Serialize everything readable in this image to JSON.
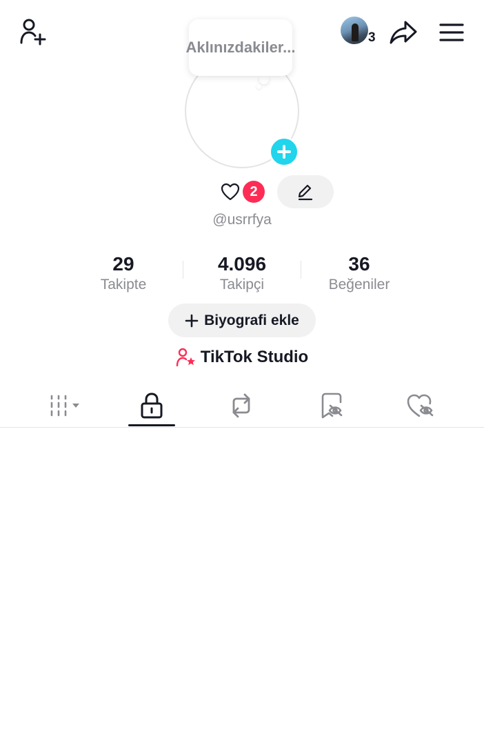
{
  "top_bar": {
    "add_friend_icon": "person-plus-icon",
    "story_count": "3",
    "share_icon": "share-arrow-icon",
    "menu_icon": "hamburger-menu-icon"
  },
  "profile": {
    "note_placeholder": "Aklınızdakiler...",
    "likes_badge": "2",
    "username": "@usrrfya",
    "stats": {
      "following": {
        "value": "29",
        "label": "Takipte"
      },
      "followers": {
        "value": "4.096",
        "label": "Takipçi"
      },
      "likes": {
        "value": "36",
        "label": "Beğeniler"
      }
    },
    "bio_button": "Biyografi ekle",
    "studio_link": "TikTok Studio"
  },
  "tabs": [
    {
      "name": "videos",
      "icon": "grid-columns-icon"
    },
    {
      "name": "private",
      "icon": "lock-icon",
      "active": true
    },
    {
      "name": "reposts",
      "icon": "repost-icon"
    },
    {
      "name": "favorites",
      "icon": "bookmark-hidden-icon"
    },
    {
      "name": "liked",
      "icon": "heart-hidden-icon"
    }
  ],
  "colors": {
    "accent_red": "#fe2c55",
    "accent_cyan": "#20d5ec",
    "text_primary": "#161823",
    "text_secondary": "#8a8b91"
  }
}
